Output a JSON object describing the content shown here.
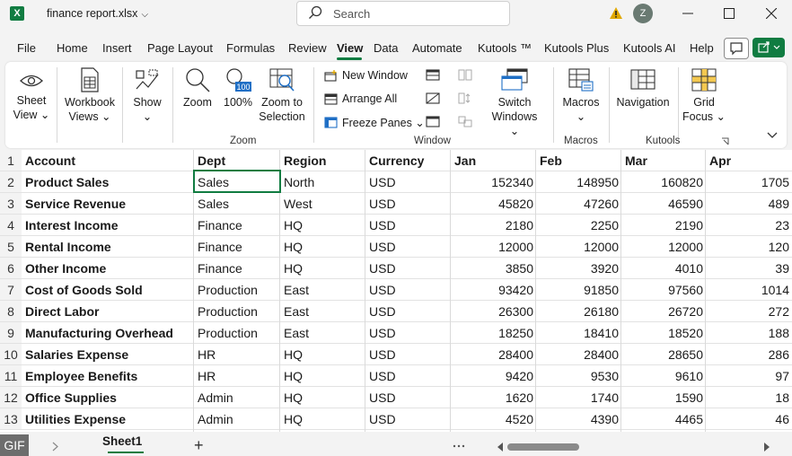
{
  "titlebar": {
    "app_logo": "X",
    "file_name": "finance report.xlsx",
    "search_placeholder": "Search",
    "user_initial": "Z"
  },
  "menu": [
    "File",
    "Home",
    "Insert",
    "Page Layout",
    "Formulas",
    "Review",
    "View",
    "Data",
    "Automate",
    "Kutools ™",
    "Kutools Plus",
    "Kutools AI",
    "Help"
  ],
  "menu_active": "View",
  "ribbon": {
    "sheet_view": [
      "Sheet",
      "View ⌄"
    ],
    "workbook_views": [
      "Workbook",
      "Views ⌄"
    ],
    "show": "Show",
    "zoom": "Zoom",
    "zoom100": "100%",
    "zoom_to_selection": [
      "Zoom to",
      "Selection"
    ],
    "zoom_group": "Zoom",
    "new_window": "New Window",
    "arrange_all": "Arrange All",
    "freeze_panes": "Freeze Panes ⌄",
    "switch_windows": [
      "Switch",
      "Windows ⌄"
    ],
    "window_group": "Window",
    "macros": "Macros",
    "macros_group": "Macros",
    "navigation": "Navigation",
    "grid_focus": [
      "Grid",
      "Focus ⌄"
    ],
    "kutools_group": "Kutools"
  },
  "grid": {
    "row_numbers": [
      "1",
      "2",
      "3",
      "4",
      "5",
      "6",
      "7",
      "8",
      "9",
      "10",
      "11",
      "12",
      "13"
    ],
    "headers": [
      "Account",
      "Dept",
      "Region",
      "Currency",
      "Jan",
      "Feb",
      "Mar",
      "Apr"
    ],
    "rows": [
      [
        "Product Sales",
        "Sales",
        "North",
        "USD",
        "152340",
        "148950",
        "160820",
        "1705"
      ],
      [
        "Service Revenue",
        "Sales",
        "West",
        "USD",
        "45820",
        "47260",
        "46590",
        "489"
      ],
      [
        "Interest Income",
        "Finance",
        "HQ",
        "USD",
        "2180",
        "2250",
        "2190",
        "23"
      ],
      [
        "Rental Income",
        "Finance",
        "HQ",
        "USD",
        "12000",
        "12000",
        "12000",
        "120"
      ],
      [
        "Other Income",
        "Finance",
        "HQ",
        "USD",
        "3850",
        "3920",
        "4010",
        "39"
      ],
      [
        "Cost of Goods Sold",
        "Production",
        "East",
        "USD",
        "93420",
        "91850",
        "97560",
        "1014"
      ],
      [
        "Direct Labor",
        "Production",
        "East",
        "USD",
        "26300",
        "26180",
        "26720",
        "272"
      ],
      [
        "Manufacturing Overhead",
        "Production",
        "East",
        "USD",
        "18250",
        "18410",
        "18520",
        "188"
      ],
      [
        "Salaries Expense",
        "HR",
        "HQ",
        "USD",
        "28400",
        "28400",
        "28650",
        "286"
      ],
      [
        "Employee Benefits",
        "HR",
        "HQ",
        "USD",
        "9420",
        "9530",
        "9610",
        "97"
      ],
      [
        "Office Supplies",
        "Admin",
        "HQ",
        "USD",
        "1620",
        "1740",
        "1590",
        "18"
      ],
      [
        "Utilities Expense",
        "Admin",
        "HQ",
        "USD",
        "4520",
        "4390",
        "4465",
        "46"
      ]
    ]
  },
  "tabs": {
    "gif_badge": "GIF",
    "sheet1": "Sheet1",
    "add_sheet": "+"
  },
  "colors": {
    "accent": "#107c41",
    "warning": "#e0a800"
  }
}
